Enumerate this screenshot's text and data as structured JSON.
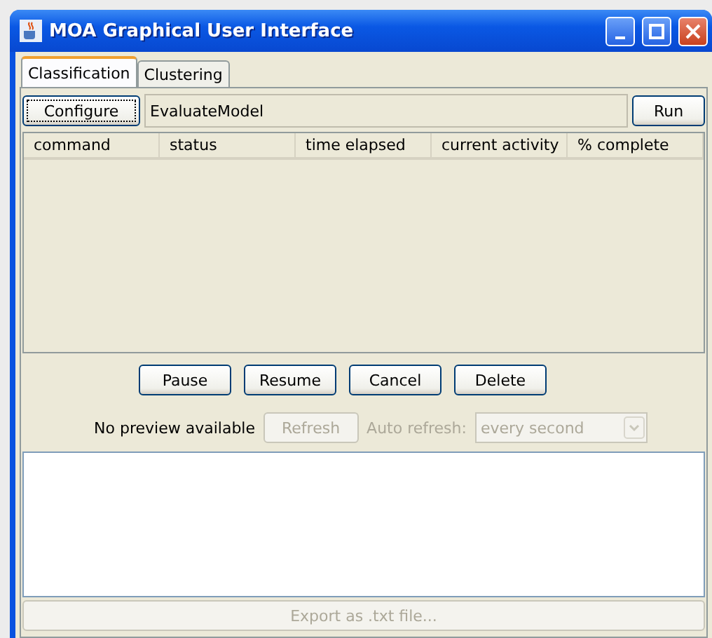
{
  "window": {
    "title": "MOA Graphical User Interface"
  },
  "tabs": [
    {
      "label": "Classification",
      "selected": true
    },
    {
      "label": "Clustering",
      "selected": false
    }
  ],
  "task": {
    "configure_button": "Configure",
    "task_field": "EvaluateModel",
    "run_button": "Run"
  },
  "table": {
    "columns": [
      "command",
      "status",
      "time elapsed",
      "current activity",
      "% complete"
    ]
  },
  "task_buttons": [
    "Pause",
    "Resume",
    "Cancel",
    "Delete"
  ],
  "preview": {
    "status": "No preview available",
    "refresh_button": {
      "label": "Refresh",
      "disabled": true
    },
    "auto_refresh_label": {
      "label": "Auto refresh:",
      "disabled": true
    },
    "auto_refresh_select": {
      "value": "every second",
      "disabled": true
    }
  },
  "export_button": {
    "label": "Export as .txt file...",
    "disabled": true
  }
}
